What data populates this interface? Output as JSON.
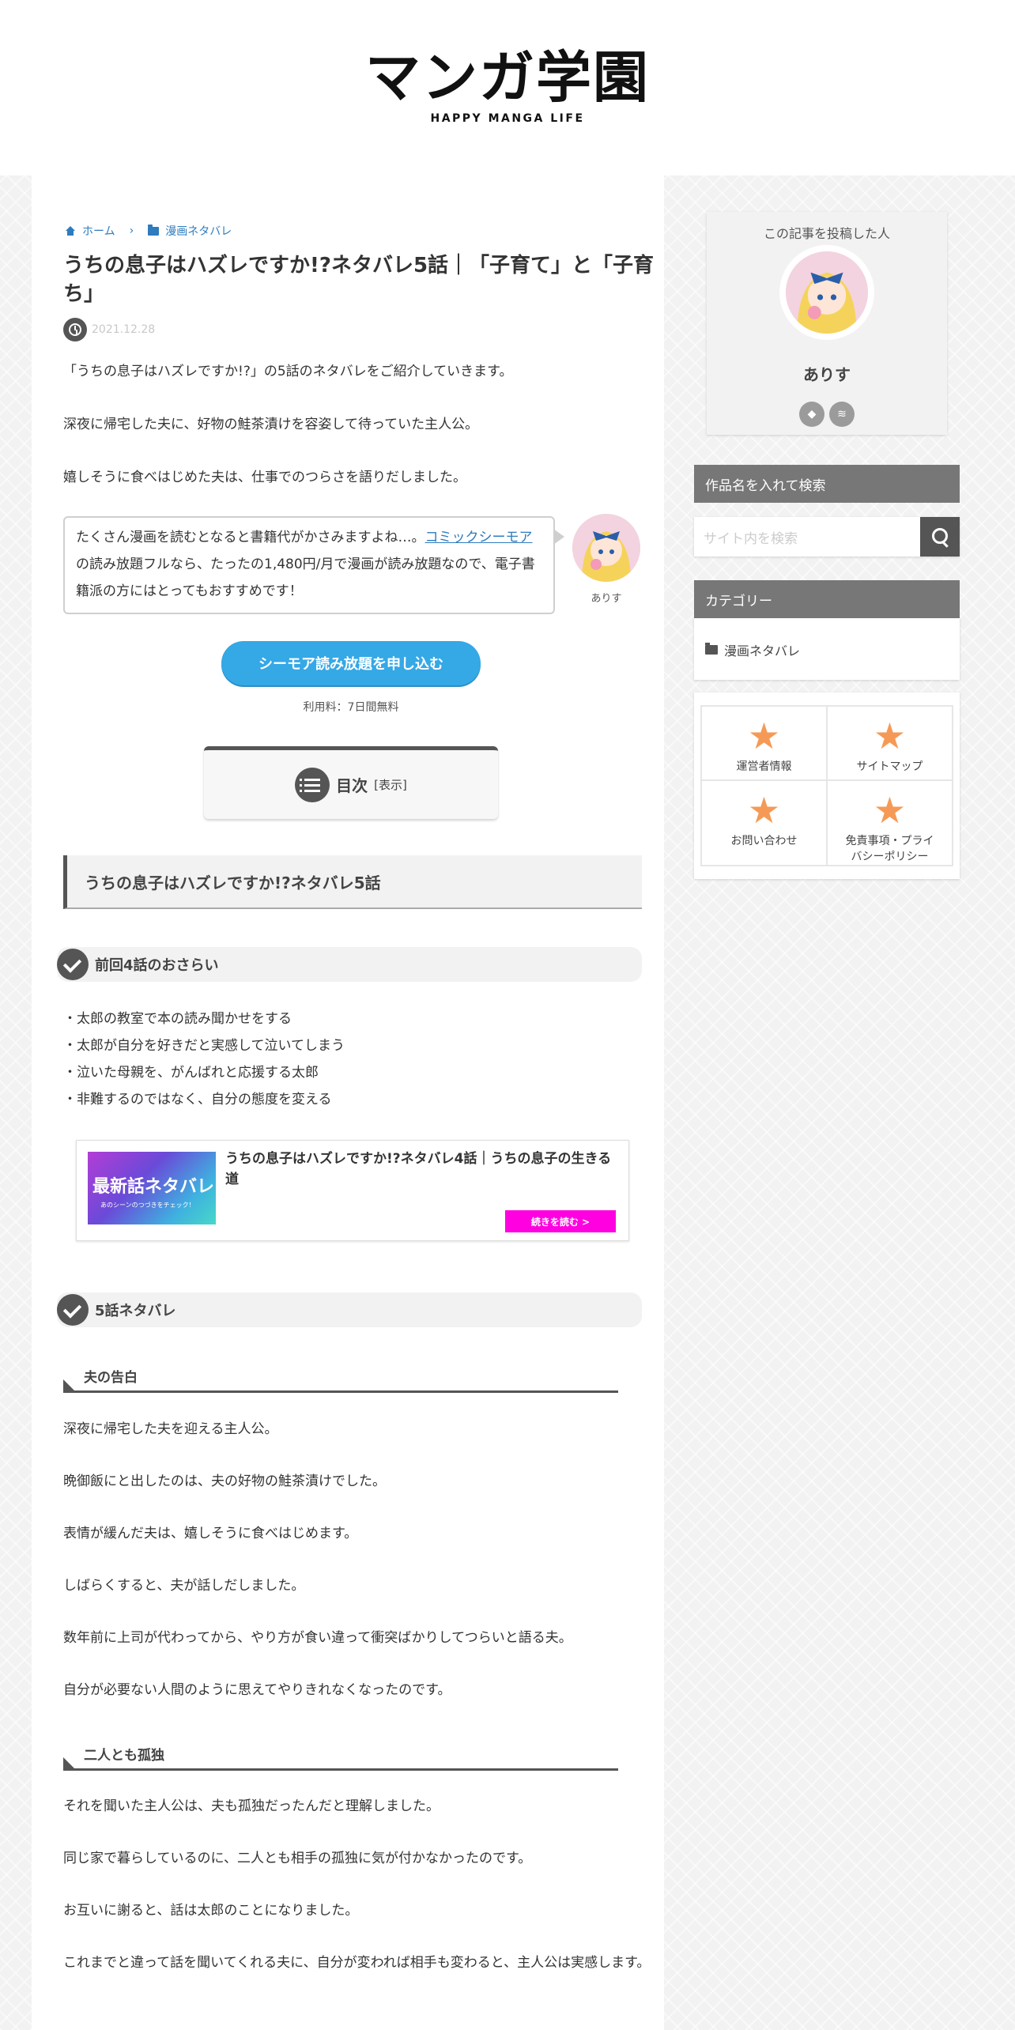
{
  "header": {
    "logo_main": "マンガ学園",
    "logo_sub": "HAPPY MANGA LIFE"
  },
  "breadcrumb": {
    "home": "ホーム",
    "category": "漫画ネタバレ"
  },
  "article": {
    "title": "うちの息子はハズレですか!?ネタバレ5話｜「子育て」と「子育ち」",
    "date": "2021.12.28",
    "intro": [
      "「うちの息子はハズレですか!?」の5話のネタバレをご紹介していきます。",
      "深夜に帰宅した夫に、好物の鮭茶漬けを容姿して待っていた主人公。",
      "嬉しそうに食べはじめた夫は、仕事でのつらさを語りだしました。"
    ],
    "bubble": {
      "text_before": "たくさん漫画を読むとなると書籍代がかさみますよね…。",
      "link": "コミックシーモア",
      "text_after": "の読み放題フルなら、たったの1,480円/月で漫画が読み放題なので、電子書籍派の方にはとってもおすすめです！",
      "avatar_name": "ありす"
    },
    "cta": {
      "label": "シーモア読み放題を申し込む",
      "note": "利用料：7日間無料"
    },
    "toc": {
      "title": "目次",
      "toggle": "[表示]"
    },
    "h2": "うちの息子はハズレですか!?ネタバレ5話",
    "section1": {
      "heading": "前回4話のおさらい",
      "items": [
        "・太郎の教室で本の読み聞かせをする",
        "・太郎が自分を好きだと実感して泣いてしまう",
        "・泣いた母親を、がんばれと応援する太郎",
        "・非難するのではなく、自分の態度を変える"
      ]
    },
    "card": {
      "thumb_title": "最新話ネタバレ",
      "thumb_sub": "あのシーンのつづきをチェック！",
      "title": "うちの息子はハズレですか!?ネタバレ4話｜うちの息子の生きる道",
      "button": "続きを読む >"
    },
    "section2": {
      "heading": "5話ネタバレ",
      "sub1": {
        "heading": "夫の告白",
        "paragraphs": [
          "深夜に帰宅した夫を迎える主人公。",
          "晩御飯にと出したのは、夫の好物の鮭茶漬けでした。",
          "表情が緩んだ夫は、嬉しそうに食べはじめます。",
          "しばらくすると、夫が話しだしました。",
          "数年前に上司が代わってから、やり方が食い違って衝突ばかりしてつらいと語る夫。",
          "自分が必要ない人間のように思えてやりきれなくなったのです。"
        ]
      },
      "sub2": {
        "heading": "二人とも孤独",
        "paragraphs": [
          "それを聞いた主人公は、夫も孤独だったんだと理解しました。",
          "同じ家で暮らしているのに、二人とも相手の孤独に気が付かなかったのです。",
          "お互いに謝ると、話は太郎のことになりました。",
          "これまでと違って話を聞いてくれる夫に、自分が変われば相手も変わると、主人公は実感します。"
        ]
      }
    }
  },
  "sidebar": {
    "author": {
      "heading": "この記事を投稿した人",
      "name": "ありす",
      "links": [
        "feedly-icon",
        "rss-icon"
      ]
    },
    "search": {
      "heading": "作品名を入れて検索",
      "placeholder": "サイト内を検索"
    },
    "categories": {
      "heading": "カテゴリー",
      "items": [
        "漫画ネタバレ"
      ]
    },
    "nav": [
      "運営者情報",
      "サイトマップ",
      "お問い合わせ",
      "免責事項・プライバシーポリシー"
    ]
  },
  "colors": {
    "accent_blue": "#35a8e6",
    "link_blue": "#2e7bbd",
    "button_magenta": "#ff00e0",
    "star_orange": "#f59a56",
    "widget_gray": "#777777"
  }
}
